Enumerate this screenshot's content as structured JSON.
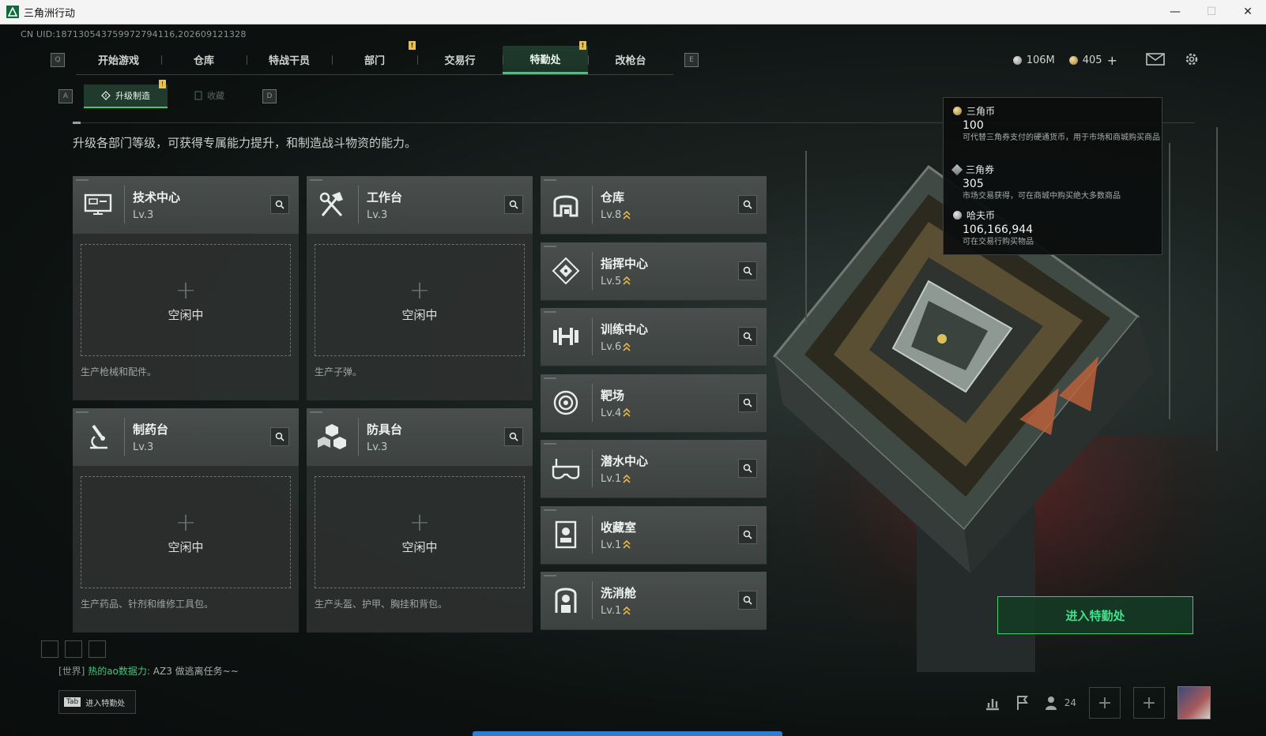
{
  "window": {
    "title": "三角洲行动",
    "minimize": "—",
    "maximize": "☐",
    "close": "✕"
  },
  "uid": "CN UID:18713054375997279411​6,202609121328",
  "nav": {
    "left_key": "Q",
    "right_key": "E",
    "tabs": [
      {
        "label": "开始游戏"
      },
      {
        "label": "仓库"
      },
      {
        "label": "特战干员"
      },
      {
        "label": "部门"
      },
      {
        "label": "交易行"
      },
      {
        "label": "特勤处"
      },
      {
        "label": "改枪台"
      }
    ],
    "badge": "!"
  },
  "resources": {
    "haf_coin": "106M",
    "triangle_coin": "405",
    "add": "+"
  },
  "subnav": {
    "left_key": "A",
    "right_key": "D",
    "tabs": [
      {
        "label": "升级制造"
      },
      {
        "label": "收藏"
      }
    ]
  },
  "description": "升级各部门等级，可获得专属能力提升，和制造战斗物资的能力。",
  "production_cards": [
    {
      "name": "技术中心",
      "level": "Lv.3",
      "idle": "空闲中",
      "plus": "+",
      "desc": "生产枪械和配件。",
      "icon": "monitor-icon"
    },
    {
      "name": "工作台",
      "level": "Lv.3",
      "idle": "空闲中",
      "plus": "+",
      "desc": "生产子弹。",
      "icon": "hammer-wrench-icon"
    },
    {
      "name": "制药台",
      "level": "Lv.3",
      "idle": "空闲中",
      "plus": "+",
      "desc": "生产药品、针剂和维修工具包。",
      "icon": "microscope-icon"
    },
    {
      "name": "防具台",
      "level": "Lv.3",
      "idle": "空闲中",
      "plus": "+",
      "desc": "生产头盔、护甲、胸挂和背包。",
      "icon": "cubes-icon"
    }
  ],
  "facilities": [
    {
      "name": "仓库",
      "level": "Lv.8",
      "icon": "warehouse-icon"
    },
    {
      "name": "指挥中心",
      "level": "Lv.5",
      "icon": "command-icon"
    },
    {
      "name": "训练中心",
      "level": "Lv.6",
      "icon": "dumbbell-icon"
    },
    {
      "name": "靶场",
      "level": "Lv.4",
      "icon": "target-icon"
    },
    {
      "name": "潜水中心",
      "level": "Lv.1",
      "icon": "dive-mask-icon"
    },
    {
      "name": "收藏室",
      "level": "Lv.1",
      "icon": "collection-icon"
    },
    {
      "name": "洗消舱",
      "level": "Lv.1",
      "icon": "decon-icon"
    }
  ],
  "tooltip": {
    "items": [
      {
        "name": "三角币",
        "value": "100",
        "desc": "可代替三角券支付的硬通货币，用于市场和商城购买商品"
      },
      {
        "name": "三角券",
        "value": "305",
        "desc": "市场交易获得，可在商城中购买绝大多数商品"
      },
      {
        "name": "哈夫币",
        "value": "106,166,944",
        "desc": "可在交易行购买物品"
      }
    ]
  },
  "enter_button": "进入特勤处",
  "chat": {
    "channel": "[世界]",
    "sender": "热的ao数据力:",
    "message": "AZ3 做逃离任务~~"
  },
  "tab_hint": {
    "key": "Tab",
    "label": "进入特勤处"
  },
  "bottom": {
    "friends": "24",
    "plus": "+"
  },
  "colors": {
    "accent": "#2fd174",
    "badge": "#e6c24a",
    "upgrade": "#e6b84a"
  }
}
